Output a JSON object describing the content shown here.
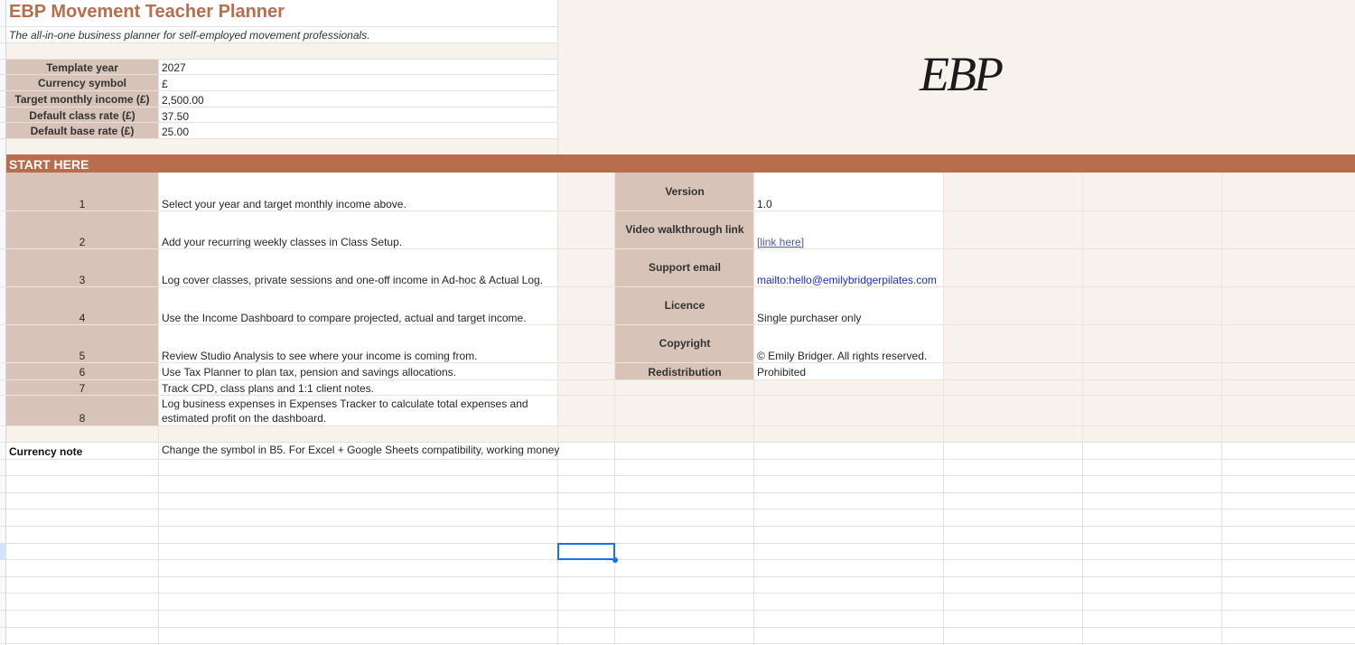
{
  "header": {
    "title": "EBP Movement Teacher Planner",
    "subtitle": "The all-in-one business planner for self-employed movement professionals.",
    "logo_text": "EBP"
  },
  "settings": [
    {
      "label": "Template year",
      "value": "2027"
    },
    {
      "label": "Currency symbol",
      "value": "£"
    },
    {
      "label": "Target monthly income (£)",
      "value": "2,500.00"
    },
    {
      "label": "Default class rate (£)",
      "value": "37.50"
    },
    {
      "label": "Default base rate (£)",
      "value": "25.00"
    }
  ],
  "start_here": {
    "heading": "START HERE",
    "steps": [
      {
        "num": "1",
        "text": "Select your year and target monthly income above."
      },
      {
        "num": "2",
        "text": "Add your recurring weekly classes in Class Setup."
      },
      {
        "num": "3",
        "text": "Log cover classes, private sessions and one-off income in Ad-hoc & Actual Log."
      },
      {
        "num": "4",
        "text": "Use the Income Dashboard to compare projected, actual and target income."
      },
      {
        "num": "5",
        "text": "Review Studio Analysis to see where your income is coming from."
      },
      {
        "num": "6",
        "text": "Use Tax Planner to plan tax, pension and savings allocations."
      },
      {
        "num": "7",
        "text": "Track CPD, class plans and 1:1 client notes."
      },
      {
        "num": "8",
        "text_line1": "Log business expenses in Expenses Tracker to calculate total expenses and",
        "text_line2": "estimated profit on the dashboard."
      }
    ]
  },
  "info": [
    {
      "label": "Version",
      "value": "1.0"
    },
    {
      "label": "Video walkthrough link",
      "value": "[link here]"
    },
    {
      "label": "Support email",
      "value": "mailto:hello@emilybridgerpilates.com"
    },
    {
      "label": "Licence",
      "value": "Single purchaser only"
    },
    {
      "label": "Copyright",
      "value": "© Emily Bridger. All rights reserved."
    },
    {
      "label": "Redistribution",
      "value": "Prohibited"
    }
  ],
  "currency_note": {
    "label": "Currency note",
    "text": "Change the symbol in B5. For Excel + Google Sheets compatibility, working money"
  },
  "colors": {
    "accent": "#b86d4c",
    "label_fill": "#d7c3b7",
    "cream_fill": "#f8f2ec",
    "selection": "#1a73e8"
  }
}
